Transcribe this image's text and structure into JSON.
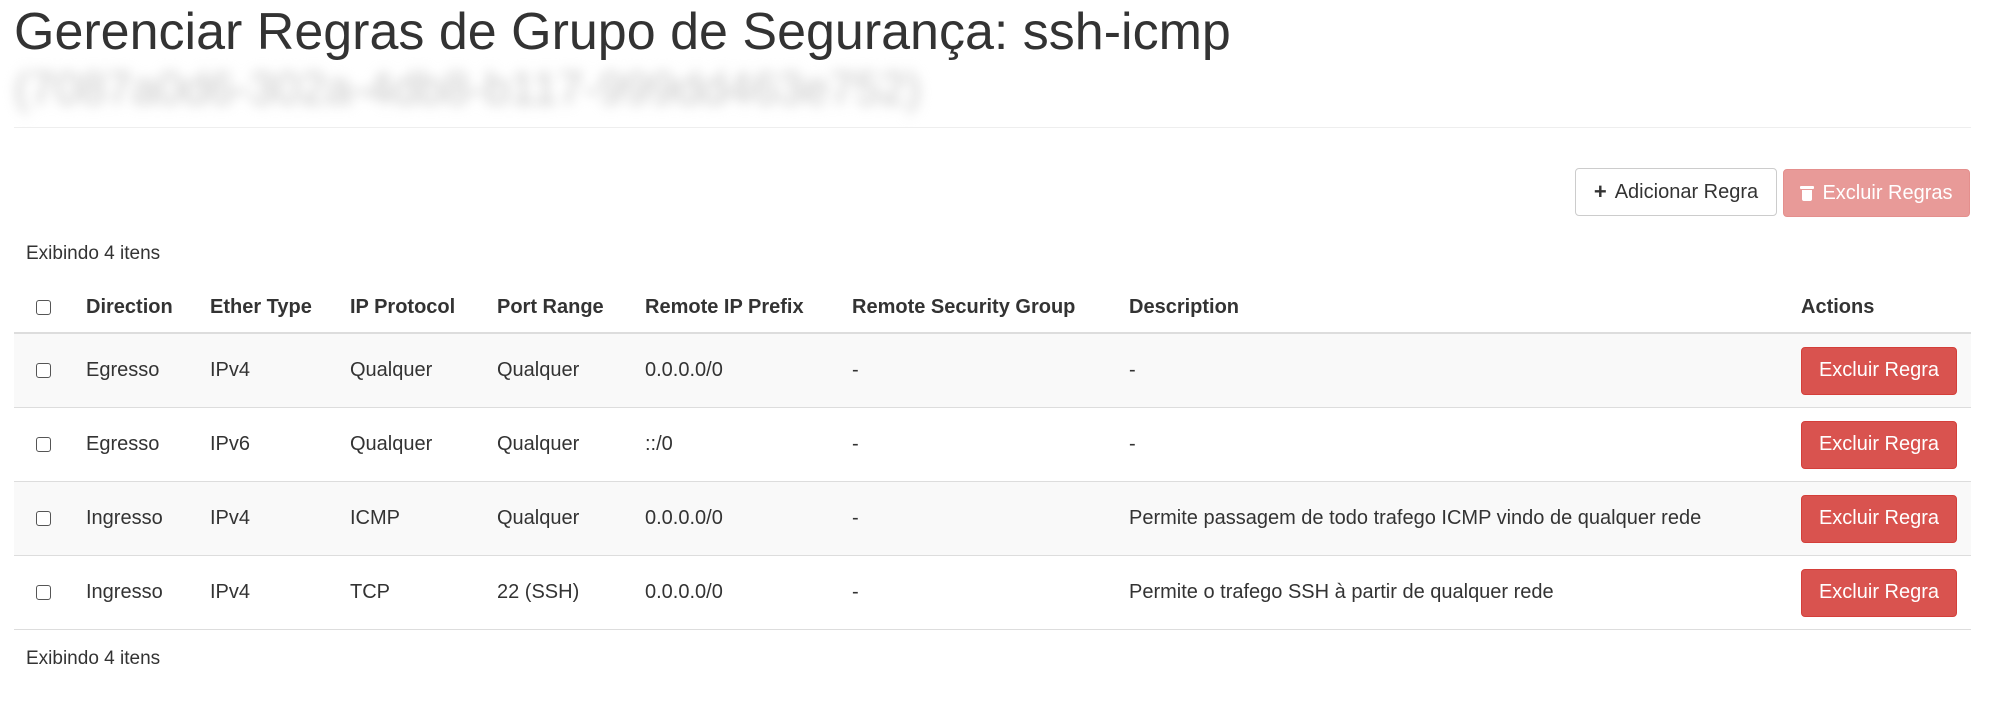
{
  "page": {
    "title": "Gerenciar Regras de Grupo de Segurança: ssh-icmp",
    "subtitle": "(7087a0d6-302a-4db8-b117-999dd463e752)"
  },
  "toolbar": {
    "add_label": "Adicionar Regra",
    "delete_all_label": "Excluir Regras"
  },
  "table": {
    "summary": "Exibindo 4 itens",
    "columns": [
      "Direction",
      "Ether Type",
      "IP Protocol",
      "Port Range",
      "Remote IP Prefix",
      "Remote Security Group",
      "Description",
      "Actions"
    ],
    "rows": [
      {
        "direction": "Egresso",
        "ether_type": "IPv4",
        "ip_protocol": "Qualquer",
        "port_range": "Qualquer",
        "remote_ip_prefix": "0.0.0.0/0",
        "remote_security_group": "-",
        "description": "-",
        "action_label": "Excluir Regra"
      },
      {
        "direction": "Egresso",
        "ether_type": "IPv6",
        "ip_protocol": "Qualquer",
        "port_range": "Qualquer",
        "remote_ip_prefix": "::/0",
        "remote_security_group": "-",
        "description": "-",
        "action_label": "Excluir Regra"
      },
      {
        "direction": "Ingresso",
        "ether_type": "IPv4",
        "ip_protocol": "ICMP",
        "port_range": "Qualquer",
        "remote_ip_prefix": "0.0.0.0/0",
        "remote_security_group": "-",
        "description": "Permite passagem de todo trafego ICMP vindo de qualquer rede",
        "action_label": "Excluir Regra"
      },
      {
        "direction": "Ingresso",
        "ether_type": "IPv4",
        "ip_protocol": "TCP",
        "port_range": "22 (SSH)",
        "remote_ip_prefix": "0.0.0.0/0",
        "remote_security_group": "-",
        "description": "Permite o trafego SSH à partir de qualquer rede",
        "action_label": "Excluir Regra"
      }
    ]
  },
  "colors": {
    "danger": "#d9534f",
    "danger_disabled": "#e89a98",
    "row_stripe": "#f9f9f9",
    "border": "#dddddd"
  },
  "icons": {
    "add": "plus-icon",
    "delete_all": "trash-icon"
  }
}
